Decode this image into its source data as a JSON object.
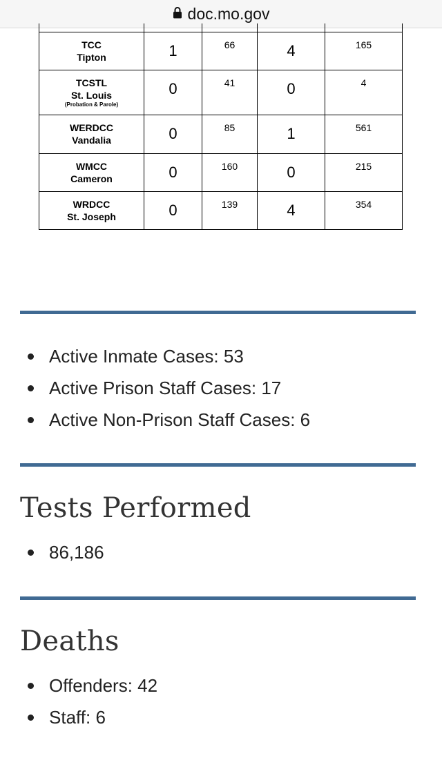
{
  "browser": {
    "domain": "doc.mo.gov"
  },
  "table": {
    "rows": [
      {
        "facility": "TCC",
        "location": "Tipton",
        "note": "",
        "c1": "1",
        "c2": "66",
        "c3": "4",
        "c4": "165"
      },
      {
        "facility": "TCSTL",
        "location": "St. Louis",
        "note": "(Probation & Parole)",
        "c1": "0",
        "c2": "41",
        "c3": "0",
        "c4": "4"
      },
      {
        "facility": "WERDCC",
        "location": "Vandalia",
        "note": "",
        "c1": "0",
        "c2": "85",
        "c3": "1",
        "c4": "561"
      },
      {
        "facility": "WMCC",
        "location": "Cameron",
        "note": "",
        "c1": "0",
        "c2": "160",
        "c3": "0",
        "c4": "215"
      },
      {
        "facility": "WRDCC",
        "location": "St. Joseph",
        "note": "",
        "c1": "0",
        "c2": "139",
        "c3": "4",
        "c4": "354"
      }
    ]
  },
  "active_cases": {
    "items": [
      "Active Inmate Cases: 53",
      "Active Prison Staff Cases: 17",
      "Active Non-Prison Staff Cases: 6"
    ]
  },
  "tests": {
    "heading": "Tests Performed",
    "items": [
      "86,186"
    ]
  },
  "deaths": {
    "heading": "Deaths",
    "items": [
      "Offenders: 42",
      "Staff: 6"
    ]
  }
}
